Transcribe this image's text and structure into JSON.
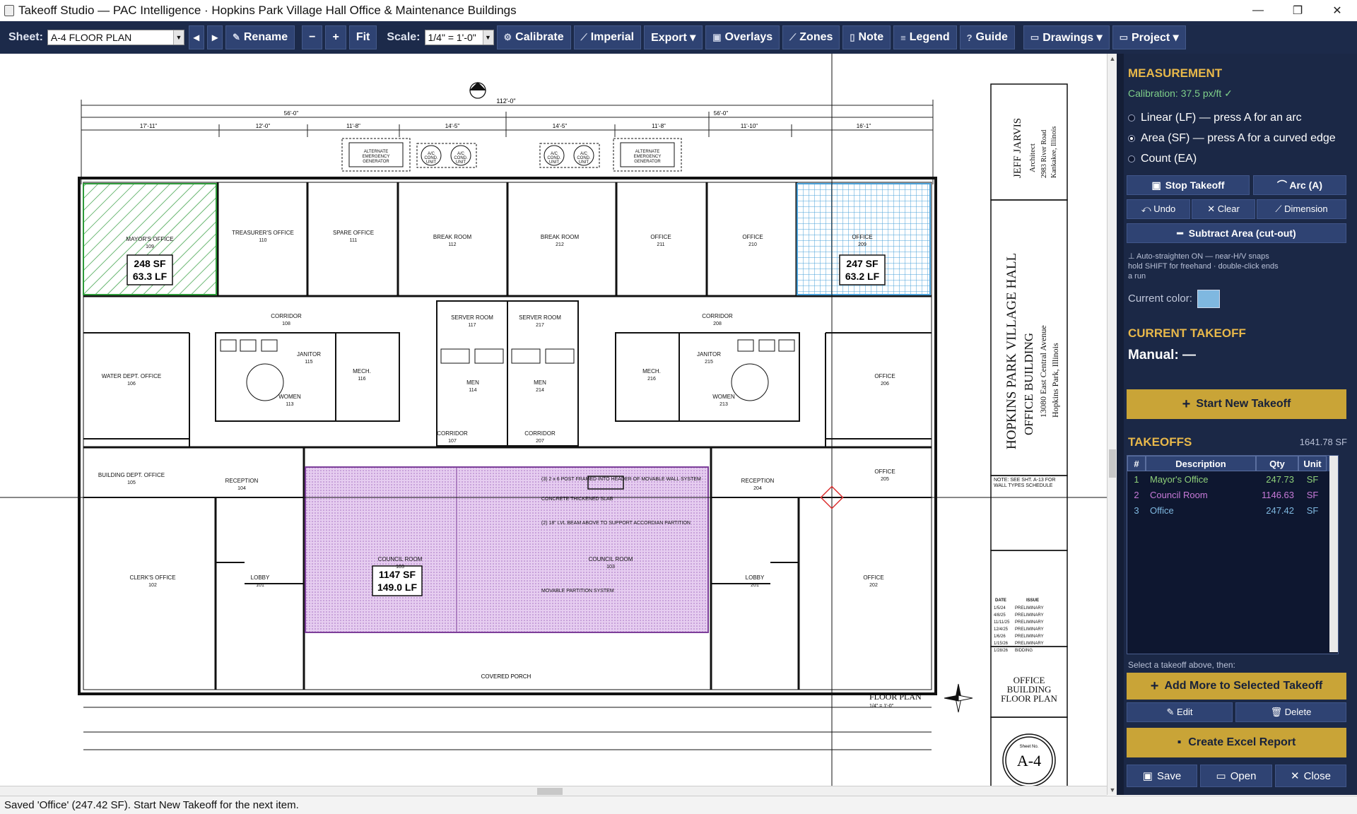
{
  "window": {
    "title": "Takeoff Studio — PAC Intelligence  ·  Hopkins Park Village Hall Office & Maintenance Buildings",
    "minimize": "—",
    "maximize": "❐",
    "close": "✕"
  },
  "toolbar": {
    "sheet_label": "Sheet:",
    "sheet_value": "A-4 FLOOR PLAN",
    "prev": "◂",
    "next": "▸",
    "rename": "Rename",
    "zoom_out": "−",
    "zoom_in": "+",
    "fit": "Fit",
    "scale_label": "Scale:",
    "scale_value": "1/4\" = 1'-0\"",
    "calibrate": "Calibrate",
    "imperial": "Imperial",
    "export": "Export ▾",
    "overlays": "Overlays",
    "zones": "Zones",
    "note": "Note",
    "legend": "Legend",
    "guide": "Guide",
    "drawings": "Drawings ▾",
    "project": "Project ▾"
  },
  "drawing": {
    "overall_width": "112'-0\"",
    "dims_top": [
      "17'-11\"",
      "12'-0\"",
      "56'-0\"",
      "11'-8\"",
      "14'-5\"",
      "14'-5\"",
      "11'-8\"",
      "56'-0\"",
      "11'-10\"",
      "16'-1\""
    ],
    "equipment": [
      "ALTERNATE EMERGENCY GENERATOR",
      "A/C COND. UNIT",
      "A/C COND. UNIT",
      "A/C COND. UNIT",
      "A/C COND. UNIT",
      "ALTERNATE EMERGENCY GENERATOR"
    ],
    "rooms": [
      {
        "name": "MAYOR'S OFFICE",
        "num": "109"
      },
      {
        "name": "TREASURER'S OFFICE",
        "num": "110"
      },
      {
        "name": "SPARE OFFICE",
        "num": "111"
      },
      {
        "name": "BREAK ROOM",
        "num": "112"
      },
      {
        "name": "BREAK ROOM",
        "num": "212"
      },
      {
        "name": "OFFICE",
        "num": "211"
      },
      {
        "name": "OFFICE",
        "num": "210"
      },
      {
        "name": "OFFICE",
        "num": "209"
      },
      {
        "name": "CORRIDOR",
        "num": "108"
      },
      {
        "name": "SERVER ROOM",
        "num": "117"
      },
      {
        "name": "SERVER ROOM",
        "num": "217"
      },
      {
        "name": "CORRIDOR",
        "num": "208"
      },
      {
        "name": "WATER DEPT. OFFICE",
        "num": "106"
      },
      {
        "name": "JANITOR",
        "num": "115"
      },
      {
        "name": "MECH.",
        "num": "116"
      },
      {
        "name": "MEN",
        "num": "114"
      },
      {
        "name": "MEN",
        "num": "214"
      },
      {
        "name": "MECH.",
        "num": "216"
      },
      {
        "name": "JANITOR",
        "num": "215"
      },
      {
        "name": "OFFICE",
        "num": "206"
      },
      {
        "name": "WOMEN",
        "num": "113"
      },
      {
        "name": "WOMEN",
        "num": "213"
      },
      {
        "name": "CORRIDOR",
        "num": "107"
      },
      {
        "name": "CORRIDOR",
        "num": "207"
      },
      {
        "name": "BUILDING DEPT. OFFICE",
        "num": "105"
      },
      {
        "name": "RECEPTION",
        "num": "104"
      },
      {
        "name": "RECEPTION",
        "num": "204"
      },
      {
        "name": "OFFICE",
        "num": "205"
      },
      {
        "name": "COUNCIL ROOM",
        "num": "103"
      },
      {
        "name": "COUNCIL ROOM",
        "num": "103"
      },
      {
        "name": "CLERK'S OFFICE",
        "num": "102"
      },
      {
        "name": "LOBBY",
        "num": "101"
      },
      {
        "name": "LOBBY",
        "num": "201"
      },
      {
        "name": "OFFICE",
        "num": "202"
      }
    ],
    "measure_tags": [
      {
        "area": "248 SF",
        "lf": "63.3 LF"
      },
      {
        "area": "247 SF",
        "lf": "63.2 LF"
      },
      {
        "area": "1147 SF",
        "lf": "149.0 LF"
      }
    ],
    "notes": [
      "(3) 2 x 6 POST FRAMED INTO HEADER OF MOVABLE WALL SYSTEM",
      "CONCRETE THICKENED SLAB",
      "(2) 18\" LVL BEAM ABOVE TO SUPPORT ACCORDIAN PARTITION",
      "MOVABLE PARTITION SYSTEM"
    ],
    "covered_porch": "COVERED PORCH",
    "plan_title": "FLOOR PLAN",
    "plan_scale": "1/4\" = 1'-0\"",
    "title_block": {
      "architect": "JEFF JARVIS",
      "architect_sub": "Architect",
      "address1": "2983 River Road",
      "address2": "Kankakee, Illinois",
      "project": "HOPKINS PARK VILLAGE HALL",
      "project2": "OFFICE BUILDING",
      "project_addr": "13080 East Central Avenue",
      "project_city": "Hopkins Park, Illinois",
      "note": "NOTE: SEE SHT. A-13 FOR WALL TYPES SCHEDULE",
      "rev_head": [
        "DATE",
        "ISSUE"
      ],
      "revs": [
        [
          "1/5/24",
          "PRELIMINARY"
        ],
        [
          "4/8/25",
          "PRELIMINARY"
        ],
        [
          "11/11/25",
          "PRELIMINARY"
        ],
        [
          "12/4/25",
          "PRELIMINARY"
        ],
        [
          "1/6/26",
          "PRELIMINARY"
        ],
        [
          "1/15/26",
          "PRELIMINARY"
        ],
        [
          "1/28/26",
          "BIDDING"
        ]
      ],
      "sheet_title": "OFFICE BUILDING FLOOR PLAN",
      "sheet_no_label": "Sheet No.",
      "sheet_no": "A-4"
    }
  },
  "panel": {
    "measurement_title": "MEASUREMENT",
    "calibration": "Calibration: 37.5 px/ft ✓",
    "mode_linear": "Linear  (LF)  —  press A for an arc",
    "mode_area": "Area  (SF)  —  press A for a curved edge",
    "mode_count": "Count  (EA)",
    "selected_mode": "area",
    "stop_takeoff": "Stop Takeoff",
    "arc": "⌒ Arc (A)",
    "undo": "⤺ Undo",
    "clear": "✕ Clear",
    "dimension": "⟋ Dimension",
    "subtract": "Subtract Area (cut-out)",
    "hint1": "⊥ Auto-straighten ON — near-H/V snaps",
    "hint2": "hold SHIFT for freehand · double-click ends",
    "hint3": "a run",
    "current_color_label": "Current color:",
    "current_color": "#7fb8e0",
    "current_title": "CURRENT TAKEOFF",
    "current_value": "Manual: —",
    "start_new": "Start New Takeoff",
    "takeoffs_title": "TAKEOFFS",
    "takeoffs_total": "1641.78 SF",
    "table_head": [
      "#",
      "Description",
      "Qty",
      "Unit"
    ],
    "rows": [
      {
        "n": "1",
        "desc": "Mayor's Office",
        "qty": "247.73",
        "unit": "SF",
        "color": "#8fd07a"
      },
      {
        "n": "2",
        "desc": "Council Room",
        "qty": "1146.63",
        "unit": "SF",
        "color": "#c77ad8"
      },
      {
        "n": "3",
        "desc": "Office",
        "qty": "247.42",
        "unit": "SF",
        "color": "#7fb8e0"
      }
    ],
    "select_hint": "Select a takeoff above, then:",
    "add_more": "Add More to Selected Takeoff",
    "edit": "✎ Edit",
    "delete": "🗑 Delete",
    "excel": "Create Excel Report",
    "save": "Save",
    "open": "Open",
    "close": "Close"
  },
  "status": "Saved 'Office' (247.42 SF). Start New Takeoff for the next item."
}
